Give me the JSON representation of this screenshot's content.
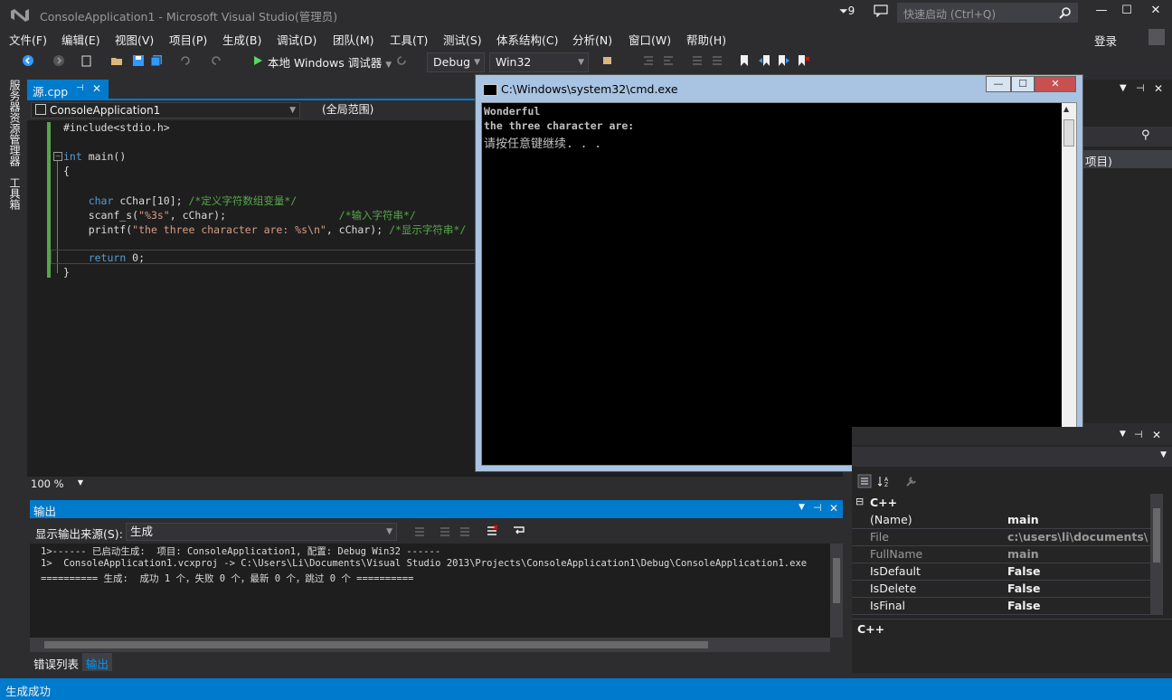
{
  "window": {
    "title": "ConsoleApplication1 - Microsoft Visual Studio(管理员)",
    "notification_count": "9",
    "quick_launch_placeholder": "快速启动 (Ctrl+Q)",
    "login": "登录"
  },
  "menu": [
    "文件(F)",
    "编辑(E)",
    "视图(V)",
    "项目(P)",
    "生成(B)",
    "调试(D)",
    "团队(M)",
    "工具(T)",
    "测试(S)",
    "体系结构(C)",
    "分析(N)",
    "窗口(W)",
    "帮助(H)"
  ],
  "toolbar": {
    "start_label": "本地 Windows 调试器",
    "config": "Debug",
    "platform": "Win32"
  },
  "left_tabs": [
    "服务器资源管理器",
    "工具箱"
  ],
  "editor": {
    "tab_label": "源.cpp",
    "nav_project": "ConsoleApplication1",
    "nav_scope": "(全局范围)",
    "zoom": "100 %",
    "code": [
      "#include<stdio.h>",
      "",
      "int main()",
      "{",
      "",
      "    char cChar[10]; /*定义字符数组变量*/",
      "    scanf_s(\"%3s\", cChar);                  /*输入字符串*/",
      "    printf(\"the three character are: %s\\n\", cChar); /*显示字符串*/",
      "",
      "    return 0;",
      "}"
    ]
  },
  "console": {
    "title": "C:\\Windows\\system32\\cmd.exe",
    "lines": [
      "Wonderful",
      "the three character are:",
      "请按任意键继续. . ."
    ]
  },
  "output": {
    "header": "输出",
    "source_label": "显示输出来源(S):",
    "source_value": "生成",
    "lines": [
      "1>------ 已启动生成:  项目: ConsoleApplication1, 配置: Debug Win32 ------",
      "1>  ConsoleApplication1.vcxproj -> C:\\Users\\Li\\Documents\\Visual Studio 2013\\Projects\\ConsoleApplication1\\Debug\\ConsoleApplication1.exe",
      "========== 生成:  成功 1 个，失败 0 个，最新 0 个，跳过 0 个 =========="
    ],
    "tabs": [
      "错误列表",
      "输出"
    ]
  },
  "right_panel": {
    "partial_item": "项目)"
  },
  "properties": {
    "group": "C++",
    "rows": [
      {
        "k": "(Name)",
        "v": "main",
        "dim": false
      },
      {
        "k": "File",
        "v": "c:\\users\\li\\documents\\vis",
        "dim": true
      },
      {
        "k": "FullName",
        "v": "main",
        "dim": true
      },
      {
        "k": "IsDefault",
        "v": "False",
        "dim": false
      },
      {
        "k": "IsDelete",
        "v": "False",
        "dim": false
      },
      {
        "k": "IsFinal",
        "v": "False",
        "dim": false
      }
    ],
    "footer": "C++"
  },
  "status": "生成成功",
  "colors": {
    "accent": "#007acc",
    "background": "#2d2d30",
    "editor": "#1e1e1e"
  }
}
